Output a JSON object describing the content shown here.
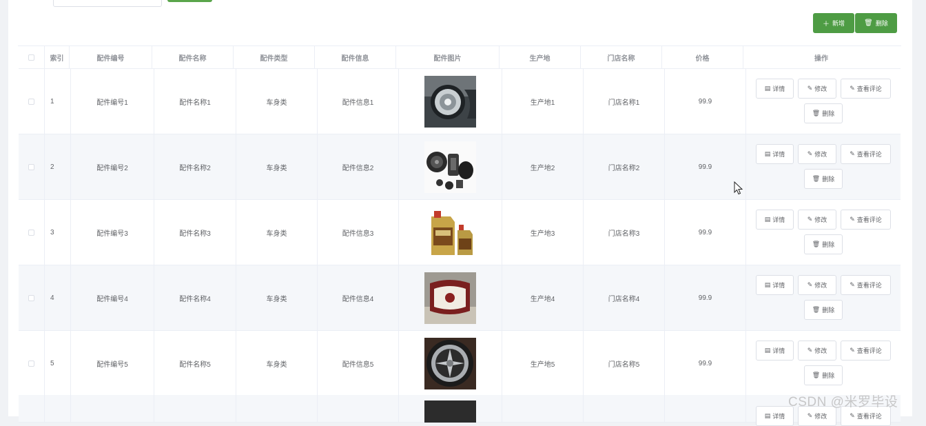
{
  "toolbar": {
    "add_label": "新增",
    "delete_label": "删除",
    "add_icon": "plus-icon",
    "delete_icon": "trash-icon",
    "accent": "#4e9c44"
  },
  "columns": [
    "索引",
    "配件编号",
    "配件名称",
    "配件类型",
    "配件信息",
    "配件图片",
    "生产地",
    "门店名称",
    "价格",
    "操作"
  ],
  "actions": {
    "detail": "详情",
    "edit": "修改",
    "comments": "查看评论",
    "delete": "删除"
  },
  "rows": [
    {
      "index": "1",
      "code": "配件编号1",
      "name": "配件名称1",
      "type": "车身类",
      "info": "配件信息1",
      "image": "headlight-photo",
      "origin": "生产地1",
      "store": "门店名称1",
      "price": "99.9"
    },
    {
      "index": "2",
      "code": "配件编号2",
      "name": "配件名称2",
      "type": "车身类",
      "info": "配件信息2",
      "image": "speaker-set-photo",
      "origin": "生产地2",
      "store": "门店名称2",
      "price": "99.9"
    },
    {
      "index": "3",
      "code": "配件编号3",
      "name": "配件名称3",
      "type": "车身类",
      "info": "配件信息3",
      "image": "engine-oil-photo",
      "origin": "生产地3",
      "store": "门店名称3",
      "price": "99.9"
    },
    {
      "index": "4",
      "code": "配件编号4",
      "name": "配件名称4",
      "type": "车身类",
      "info": "配件信息4",
      "image": "seat-pillow-photo",
      "origin": "生产地4",
      "store": "门店名称4",
      "price": "99.9"
    },
    {
      "index": "5",
      "code": "配件编号5",
      "name": "配件名称5",
      "type": "车身类",
      "info": "配件信息5",
      "image": "alloy-wheel-photo",
      "origin": "生产地5",
      "store": "门店名称5",
      "price": "99.9"
    }
  ],
  "watermark": "CSDN @米罗毕设"
}
